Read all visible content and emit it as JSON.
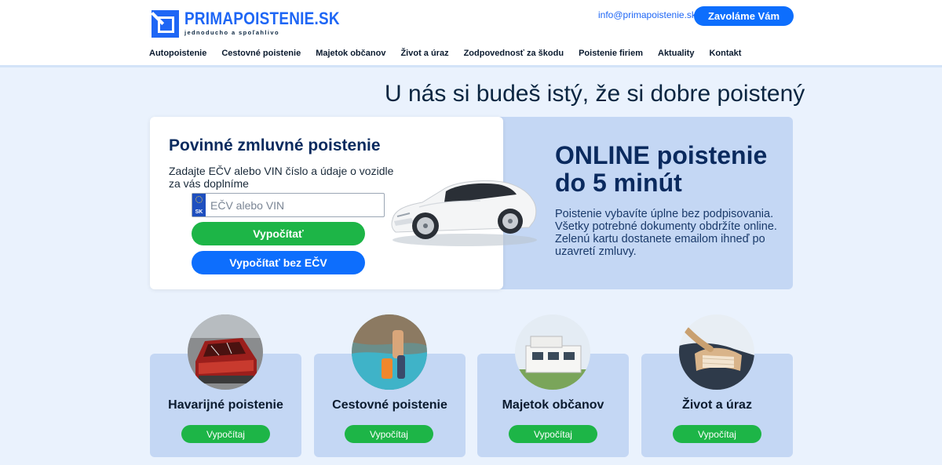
{
  "brand": {
    "name": "PRIMAPOISTENIE.SK",
    "tagline": "jednoducho a spoľahlivo",
    "color": "#1e66f5"
  },
  "header": {
    "email": "info@primapoistenie.sk",
    "call_button": "Zavoláme Vám"
  },
  "nav": {
    "items": [
      {
        "label": "Autopoistenie"
      },
      {
        "label": "Cestovné poistenie"
      },
      {
        "label": "Majetok občanov"
      },
      {
        "label": "Život a úraz"
      },
      {
        "label": "Zodpovednosť za škodu"
      },
      {
        "label": "Poistenie firiem"
      },
      {
        "label": "Aktuality"
      },
      {
        "label": "Kontakt"
      }
    ]
  },
  "hero": {
    "title": "U nás si budeš istý, že si dobre poistený"
  },
  "form": {
    "title": "Povinné zmluvné poistenie",
    "description": "Zadajte EČV alebo VIN číslo a údaje o vozidle za vás doplníme",
    "plate_country": "SK",
    "input_placeholder": "EČV alebo VIN",
    "calc_button": "Vypočítať",
    "calc_noecv_button": "Vypočítať bez EČV"
  },
  "online": {
    "title": "ONLINE poistenie do 5 minút",
    "description": "Poistenie vybavíte úplne bez podpisovania. Všetky potrebné dokumenty obdržíte online. Zelenú kartu dostanete emailom ihneď po uzavretí zmluvy."
  },
  "cards": [
    {
      "title": "Havarijné poistenie",
      "button": "Vypočítaj"
    },
    {
      "title": "Cestovné poistenie",
      "button": "Vypočítaj"
    },
    {
      "title": "Majetok občanov",
      "button": "Vypočítaj"
    },
    {
      "title": "Život a úraz",
      "button": "Vypočítaj"
    }
  ],
  "colors": {
    "primary_blue": "#0d6efd",
    "green": "#1db547",
    "panel_blue": "#c4d7f4",
    "page_bg": "#eaf2fd"
  }
}
